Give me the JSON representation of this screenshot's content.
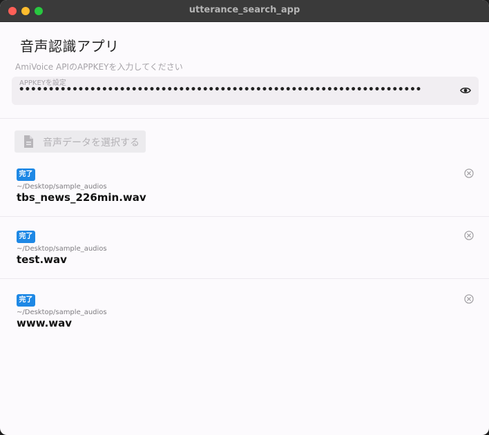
{
  "window": {
    "title": "utterance_search_app"
  },
  "app": {
    "title": "音声認識アプリ"
  },
  "apikey": {
    "hint": "AmiVoice APIのAPPKEYを入力してください",
    "label": "APPKEYを設定",
    "value": "••••••••••••••••••••••••••••••••••••••••••••••••••••••••••••••••••••",
    "visibility_icon": "eye-icon"
  },
  "select_button": {
    "label": "音声データを選択する",
    "icon": "document-icon"
  },
  "files": [
    {
      "status": "完了",
      "path": "~/Desktop/sample_audios",
      "name": "tbs_news_226min.wav"
    },
    {
      "status": "完了",
      "path": "~/Desktop/sample_audios",
      "name": "test.wav"
    },
    {
      "status": "完了",
      "path": "~/Desktop/sample_audios",
      "name": "www.wav"
    }
  ],
  "colors": {
    "badge": "#1e88e5",
    "background": "#fcfafd",
    "titlebar": "#3a3a3a"
  }
}
